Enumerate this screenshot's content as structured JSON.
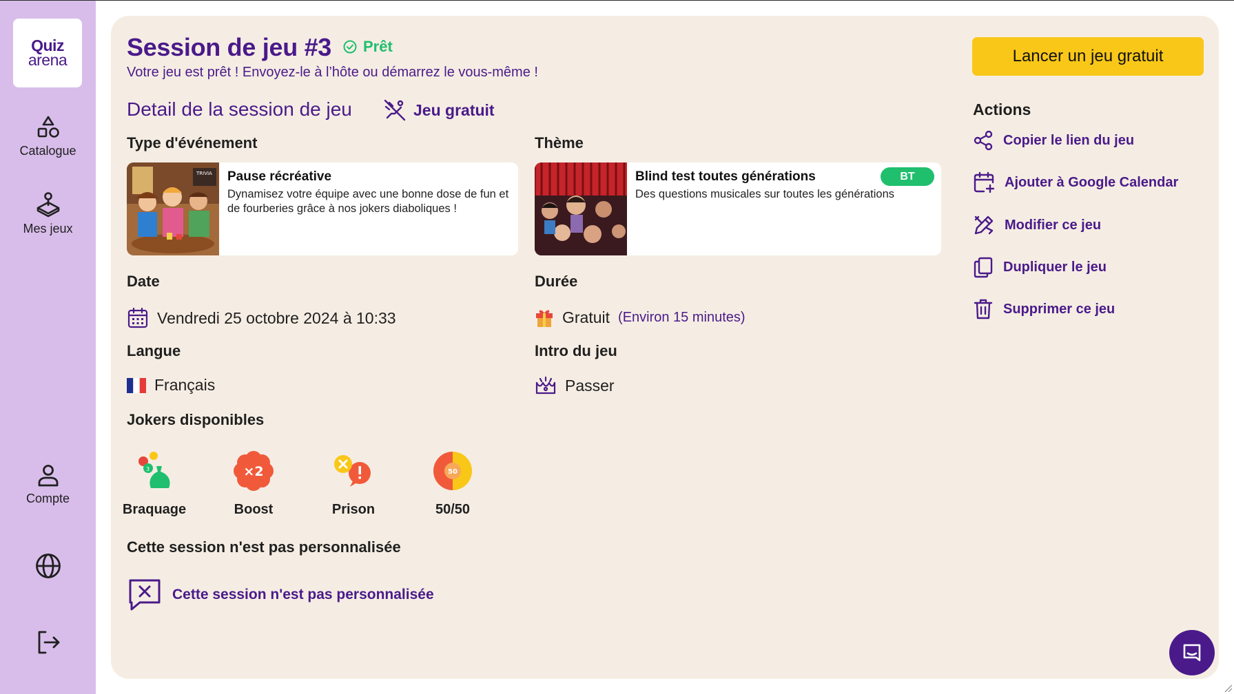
{
  "brand": {
    "line1": "Quiz",
    "line2": "arena",
    "primary_color": "#4a1a8a",
    "sidebar_color": "#d8bdea",
    "accent_yellow": "#f9c718",
    "success_green": "#1fbf6e"
  },
  "sidebar": {
    "items": [
      {
        "label": "Catalogue",
        "icon": "shapes-icon"
      },
      {
        "label": "Mes jeux",
        "icon": "game-controller-icon"
      },
      {
        "label": "Compte",
        "icon": "user-icon"
      }
    ],
    "language_icon": "globe-icon",
    "logout_icon": "logout-icon"
  },
  "header": {
    "title": "Session de jeu #3",
    "status": "Prêt",
    "subtitle": "Votre jeu est prêt ! Envoyez-le à l’hôte ou démarrez le vous-même !",
    "launch_button": "Lancer un jeu gratuit"
  },
  "details": {
    "section_title": "Detail de la session de jeu",
    "free_tag": "Jeu gratuit",
    "event_type": {
      "label": "Type d'événement",
      "title": "Pause récréative",
      "description": "Dynamisez votre équipe avec une bonne dose de fun et de fourberies grâce à nos jokers diaboliques !"
    },
    "theme": {
      "label": "Thème",
      "title": "Blind test toutes générations",
      "description": "Des questions musicales sur toutes les générations",
      "badge": "BT"
    },
    "date": {
      "label": "Date",
      "value": "Vendredi 25 octobre 2024 à 10:33"
    },
    "duration": {
      "label": "Durée",
      "value": "Gratuit",
      "note": "(Environ 15 minutes)"
    },
    "language": {
      "label": "Langue",
      "value": "Français"
    },
    "intro": {
      "label": "Intro du jeu",
      "value": "Passer"
    },
    "jokers": {
      "label": "Jokers disponibles",
      "items": [
        {
          "name": "Braquage",
          "icon": "money-bag-icon"
        },
        {
          "name": "Boost",
          "icon": "boost-x2-icon",
          "icon_text": "×2"
        },
        {
          "name": "Prison",
          "icon": "prison-icon"
        },
        {
          "name": "50/50",
          "icon": "fifty-fifty-icon",
          "icon_text": "50"
        }
      ]
    },
    "personalization": {
      "label": "Cette session n'est pas personnalisée",
      "value": "Cette session n'est pas personnalisée"
    }
  },
  "actions": {
    "title": "Actions",
    "items": [
      {
        "label": "Copier le lien du jeu",
        "icon": "share-icon"
      },
      {
        "label": "Ajouter à Google Calendar",
        "icon": "calendar-add-icon"
      },
      {
        "label": "Modifier ce jeu",
        "icon": "edit-icon"
      },
      {
        "label": "Dupliquer le jeu",
        "icon": "duplicate-icon"
      },
      {
        "label": "Supprimer ce jeu",
        "icon": "trash-icon"
      }
    ]
  },
  "chat": {
    "icon": "chat-icon"
  }
}
